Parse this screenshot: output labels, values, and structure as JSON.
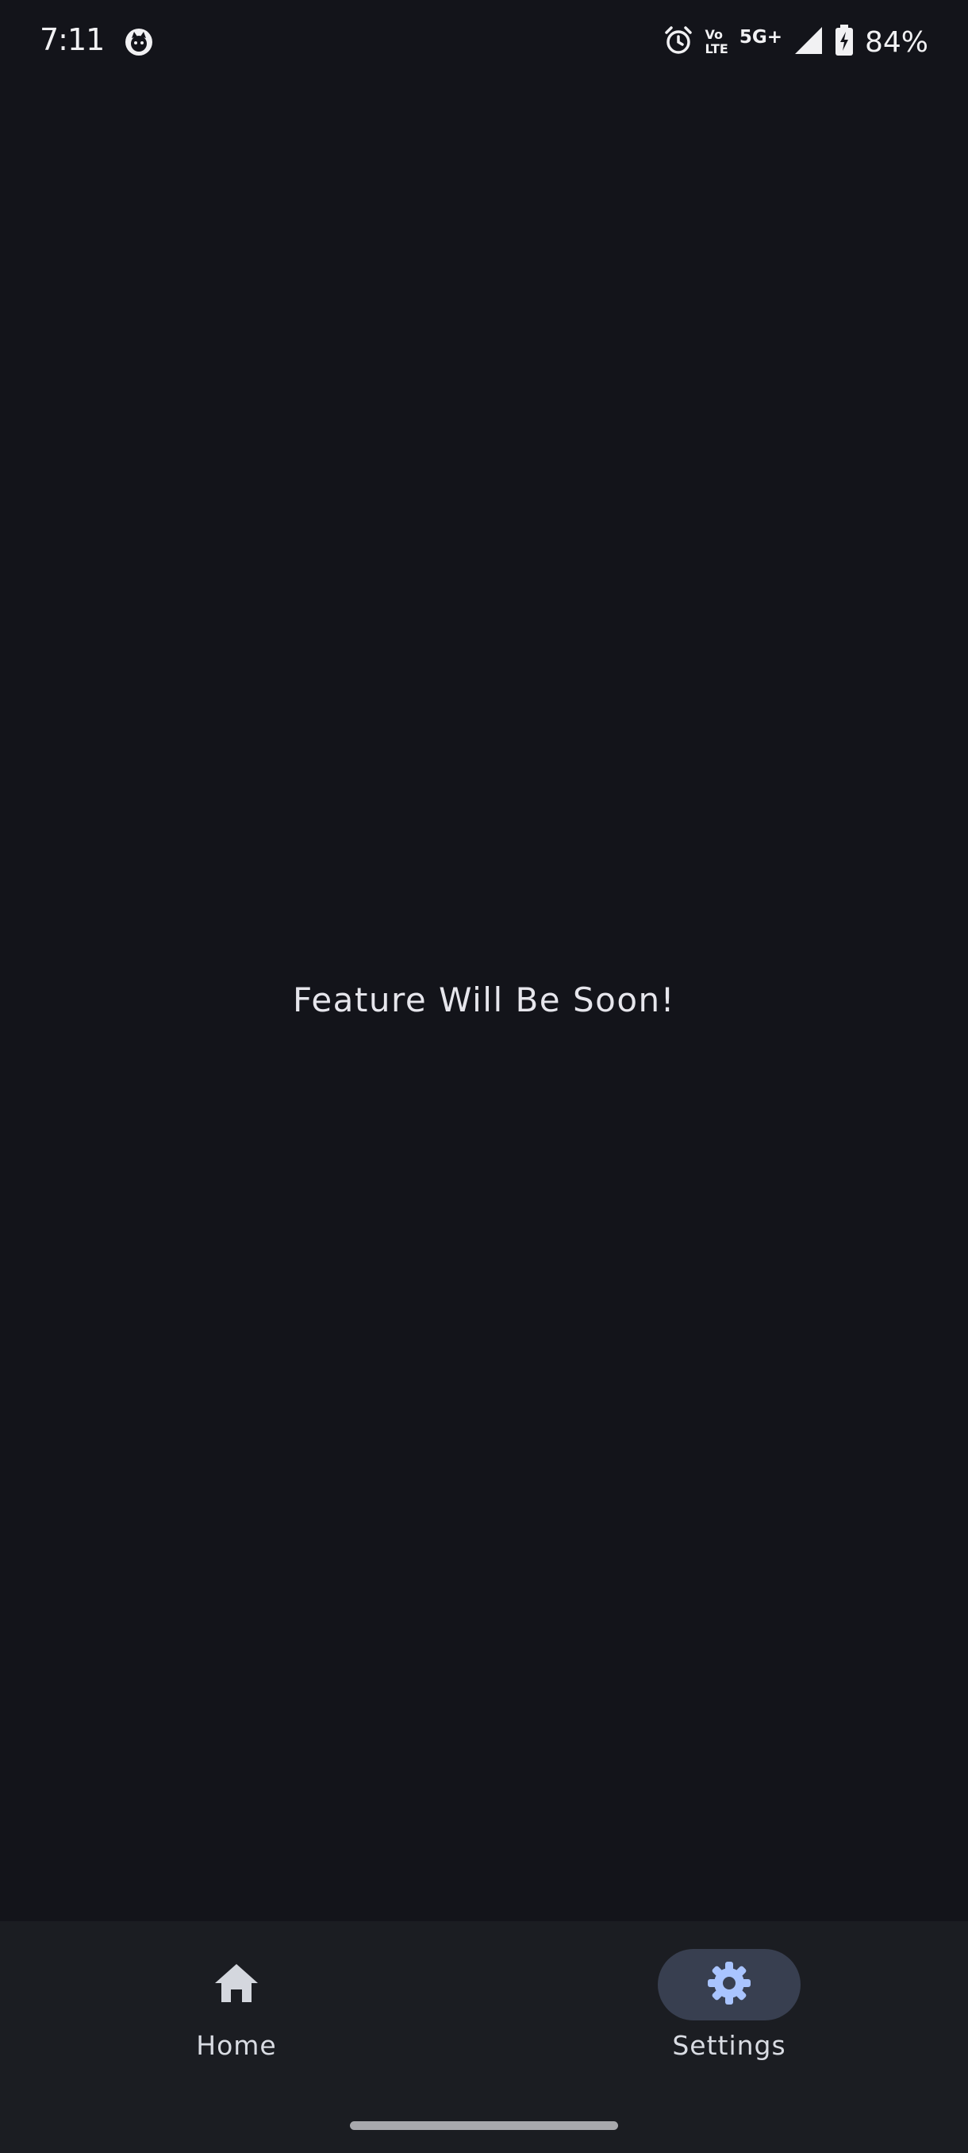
{
  "status_bar": {
    "time": "7:11",
    "volte_top": "Vo",
    "volte_bottom": "LTE",
    "network": "5G+",
    "battery": "84%"
  },
  "main": {
    "message": "Feature Will Be Soon!"
  },
  "nav": {
    "items": [
      {
        "label": "Home",
        "icon": "home-icon",
        "selected": false
      },
      {
        "label": "Settings",
        "icon": "gear-icon",
        "selected": true
      }
    ]
  },
  "colors": {
    "background": "#13141a",
    "nav_background": "#1b1d22",
    "selected_pill": "#383f50",
    "accent": "#a9c4ff"
  }
}
